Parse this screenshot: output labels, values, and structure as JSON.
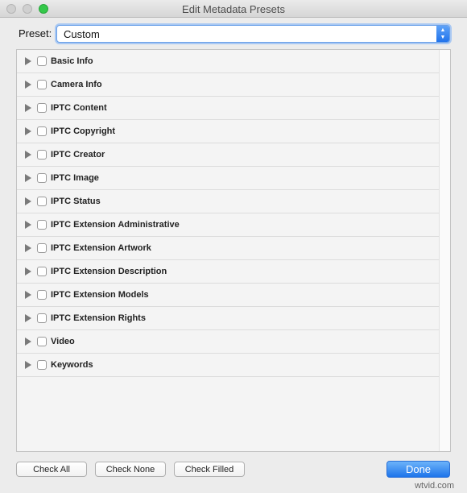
{
  "window": {
    "title": "Edit Metadata Presets"
  },
  "preset": {
    "label": "Preset:",
    "value": "Custom"
  },
  "panels": [
    {
      "label": "Basic Info"
    },
    {
      "label": "Camera Info"
    },
    {
      "label": "IPTC Content"
    },
    {
      "label": "IPTC Copyright"
    },
    {
      "label": "IPTC Creator"
    },
    {
      "label": "IPTC Image"
    },
    {
      "label": "IPTC Status"
    },
    {
      "label": "IPTC Extension Administrative"
    },
    {
      "label": "IPTC Extension Artwork"
    },
    {
      "label": "IPTC Extension Description"
    },
    {
      "label": "IPTC Extension Models"
    },
    {
      "label": "IPTC Extension Rights"
    },
    {
      "label": "Video"
    },
    {
      "label": "Keywords"
    }
  ],
  "buttons": {
    "check_all": "Check All",
    "check_none": "Check None",
    "check_filled": "Check Filled",
    "done": "Done"
  },
  "watermark": "wtvid.com",
  "icons": {
    "close": "close-button-icon",
    "minimize": "minimize-button-icon",
    "zoom": "zoom-button-icon",
    "stepper": "up-down-chevron-icon",
    "disclosure": "disclosure-triangle-icon"
  },
  "colors": {
    "accent": "#2173eb",
    "zoom_green": "#34c84a"
  }
}
